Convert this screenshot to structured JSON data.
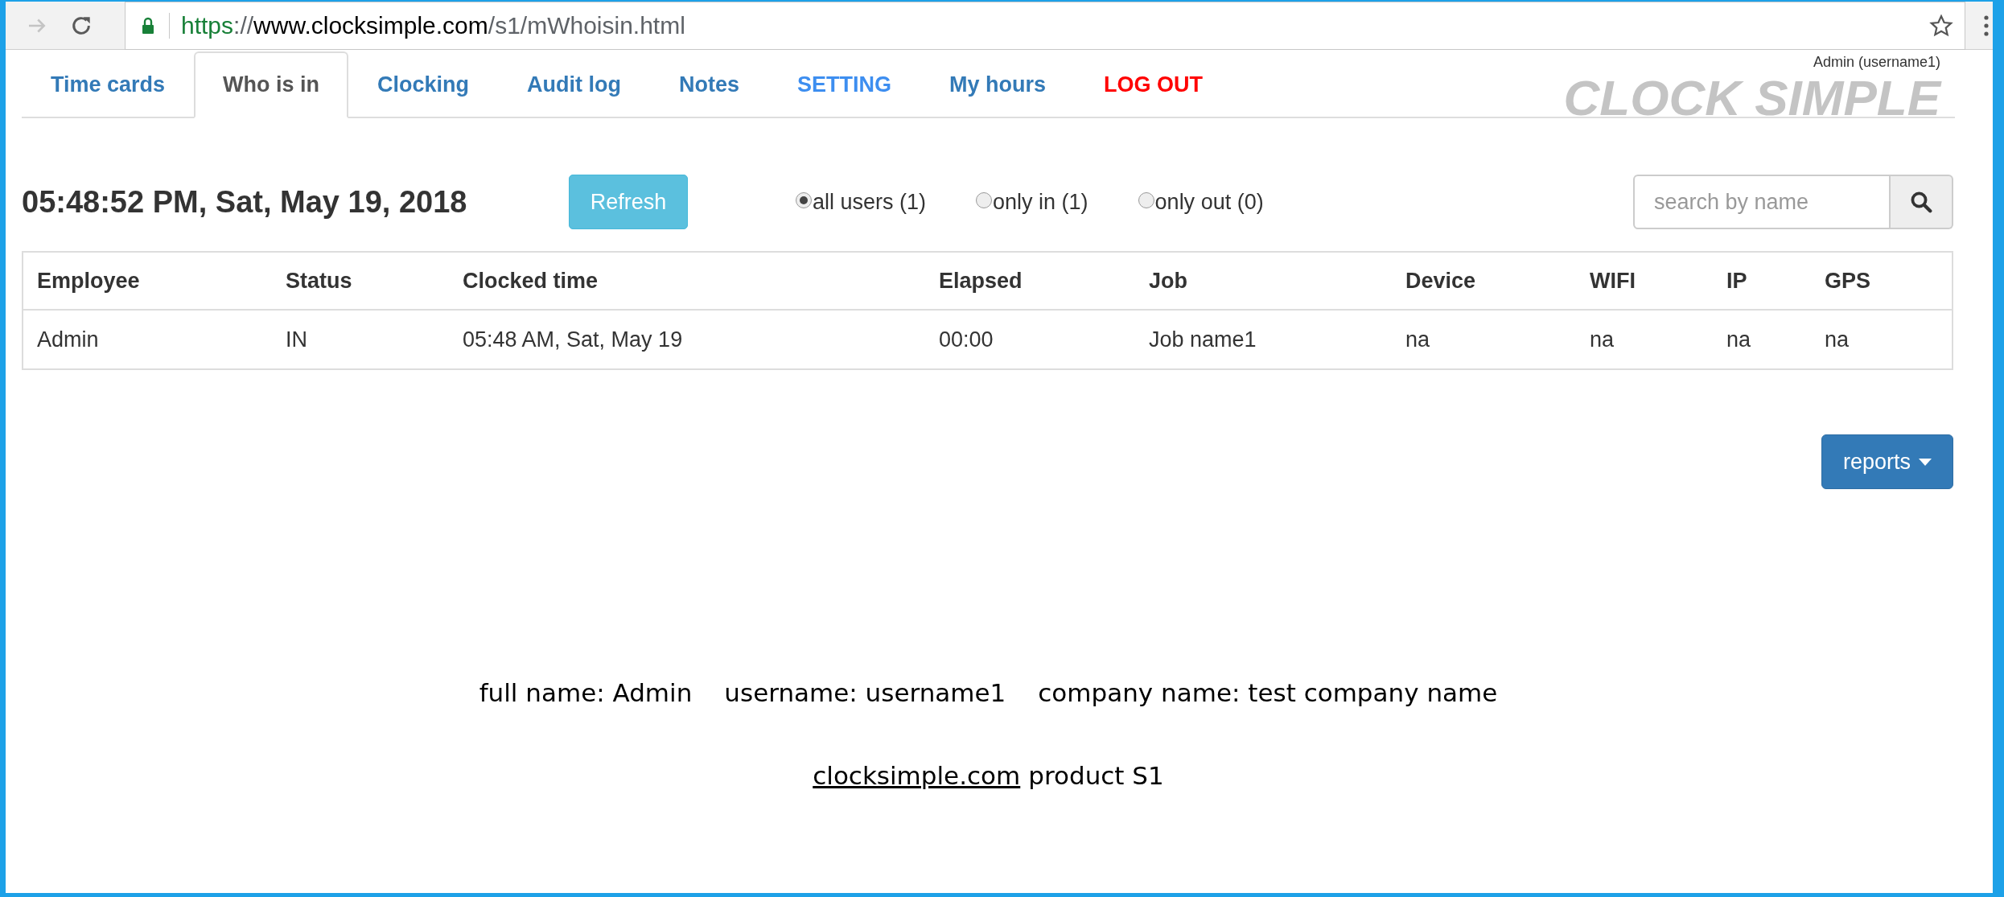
{
  "browser": {
    "url": {
      "scheme": "https",
      "separator": "://",
      "host": "www.clocksimple.com",
      "path": "/s1/mWhoisin.html"
    }
  },
  "tabs": [
    {
      "label": "Time cards",
      "selected": false,
      "kind": "normal"
    },
    {
      "label": "Who is in",
      "selected": true,
      "kind": "normal"
    },
    {
      "label": "Clocking",
      "selected": false,
      "kind": "normal"
    },
    {
      "label": "Audit log",
      "selected": false,
      "kind": "normal"
    },
    {
      "label": "Notes",
      "selected": false,
      "kind": "normal"
    },
    {
      "label": "SETTING",
      "selected": false,
      "kind": "setting"
    },
    {
      "label": "My hours",
      "selected": false,
      "kind": "normal"
    },
    {
      "label": "LOG OUT",
      "selected": false,
      "kind": "logout"
    }
  ],
  "user_label": "Admin (username1)",
  "brand": "CLOCK SIMPLE",
  "clock": "05:48:52 PM, Sat, May 19, 2018",
  "refresh_button": "Refresh",
  "filters": [
    {
      "label": "all users (1)",
      "selected": true
    },
    {
      "label": "only in (1)",
      "selected": false
    },
    {
      "label": "only out (0)",
      "selected": false
    }
  ],
  "search": {
    "placeholder": "search by name"
  },
  "table": {
    "columns": [
      "Employee",
      "Status",
      "Clocked time",
      "Elapsed",
      "Job",
      "Device",
      "WIFI",
      "IP",
      "GPS"
    ],
    "rows": [
      [
        "Admin",
        "IN",
        "05:48 AM, Sat, May 19",
        "00:00",
        "Job name1",
        "na",
        "na",
        "na",
        "na"
      ]
    ]
  },
  "reports_button": "reports",
  "footer": {
    "info": [
      "full name: Admin",
      "username: username1",
      "company name: test company name"
    ],
    "link": "clocksimple.com",
    "product": "product S1"
  }
}
